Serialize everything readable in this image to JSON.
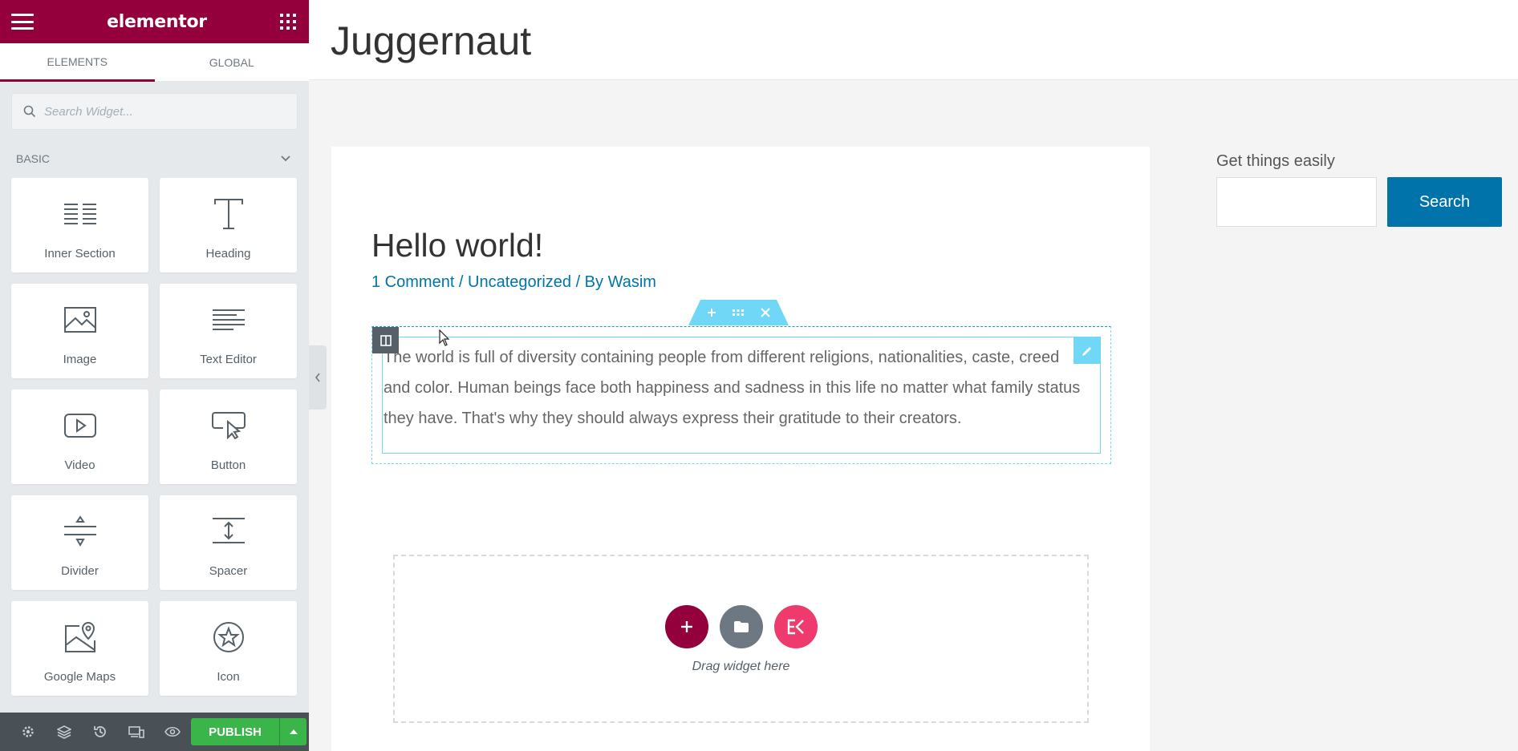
{
  "panel": {
    "logo": "elementor",
    "tabs": [
      {
        "label": "ELEMENTS",
        "active": true
      },
      {
        "label": "GLOBAL",
        "active": false
      }
    ],
    "search_placeholder": "Search Widget...",
    "category": "BASIC",
    "widgets": [
      {
        "label": "Inner Section",
        "icon": "inner-section-icon"
      },
      {
        "label": "Heading",
        "icon": "heading-icon"
      },
      {
        "label": "Image",
        "icon": "image-icon"
      },
      {
        "label": "Text Editor",
        "icon": "text-editor-icon"
      },
      {
        "label": "Video",
        "icon": "video-icon"
      },
      {
        "label": "Button",
        "icon": "button-icon"
      },
      {
        "label": "Divider",
        "icon": "divider-icon"
      },
      {
        "label": "Spacer",
        "icon": "spacer-icon"
      },
      {
        "label": "Google Maps",
        "icon": "google-maps-icon"
      },
      {
        "label": "Icon",
        "icon": "star-icon"
      }
    ],
    "footer": {
      "publish_label": "PUBLISH"
    },
    "colors": {
      "brand": "#93003c",
      "publish": "#39b54a",
      "footer": "#495157"
    }
  },
  "site": {
    "title": "Juggernaut",
    "post": {
      "title": "Hello world!",
      "meta_comment": "1 Comment",
      "meta_sep1": " / ",
      "meta_category": "Uncategorized",
      "meta_sep2": " / By ",
      "meta_author": "Wasim",
      "body": "The world is full of diversity containing people from different religions, nationalities, caste, creed and color. Human beings face both happiness and sadness in this life no matter what family status they have. That's why they should always express their gratitude to their creators."
    },
    "drop_zone_text": "Drag widget here",
    "sidebar": {
      "title": "Get things easily",
      "button": "Search"
    }
  }
}
